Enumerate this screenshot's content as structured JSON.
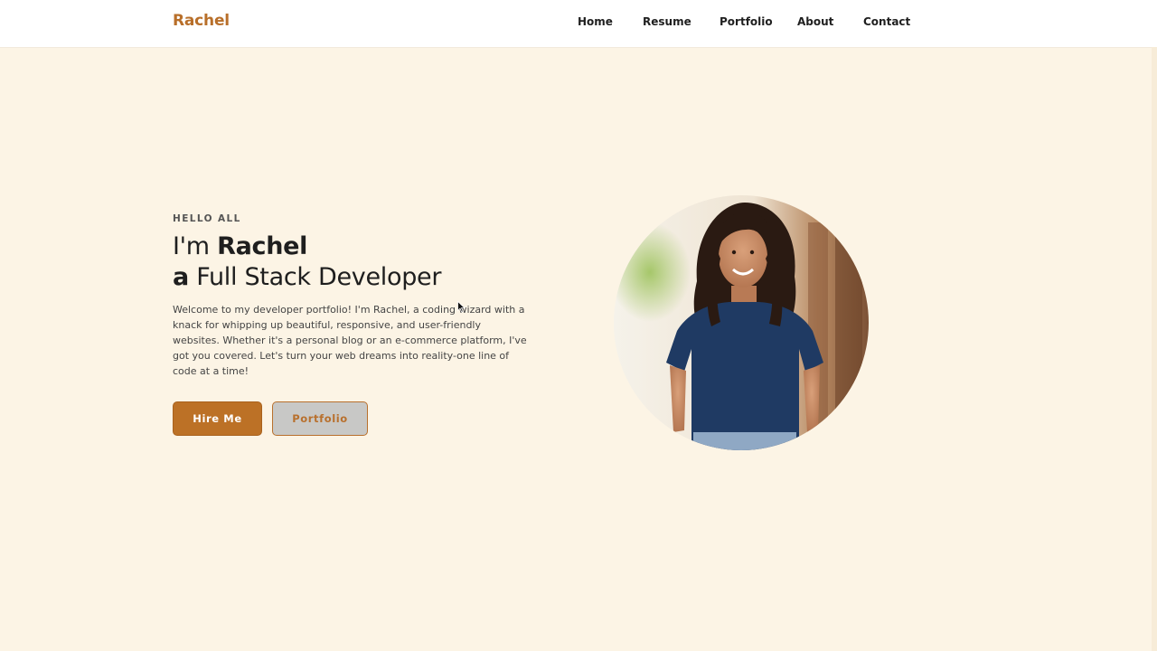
{
  "nav": {
    "logo": "Rachel",
    "links": [
      "Home",
      "Resume",
      "Portfolio",
      "About",
      "Contact"
    ]
  },
  "hero": {
    "eyebrow": "HELLO ALL",
    "line1_prefix": "I'm ",
    "line1_name": "Rachel",
    "line2_prefix": "a",
    "line2_role": " Full Stack Developer",
    "intro": "Welcome to my developer portfolio! I'm Rachel, a coding wizard with a knack for whipping up beautiful, responsive, and user-friendly websites. Whether it's a personal blog or an e-commerce platform, I've got you covered. Let's turn your web dreams into reality-one line of code at a time!",
    "buttons": {
      "hire": "Hire Me",
      "portfolio": "Portfolio"
    }
  },
  "colors": {
    "accent": "#bc7126",
    "page_background": "#fcf4e5",
    "nav_background": "#ffffff"
  },
  "icons": {
    "cursor": "arrow-cursor-icon"
  }
}
